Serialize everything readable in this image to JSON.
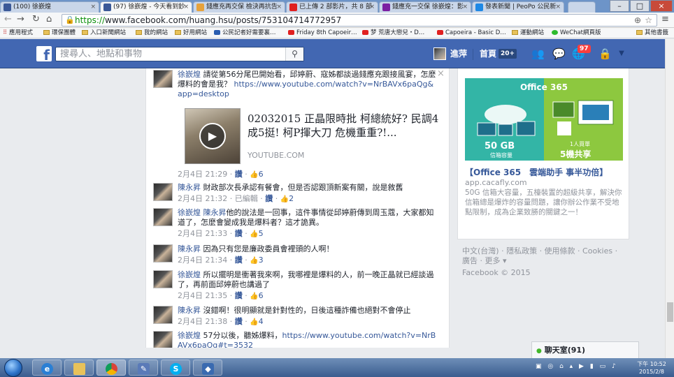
{
  "browser": {
    "tabs": [
      {
        "label": "(100) 徐嶔煌",
        "fav": "#3b5998"
      },
      {
        "label": "徐嶔煌 - 今天看到鈔…",
        "fav": "#3b5998"
      },
      {
        "label": "(97) 徐嶔煌 - 今天看到鈔",
        "fav": "#3b5998"
      },
      {
        "label": "錢應充再交保 檢決再抗告",
        "fav": "#e6a23c"
      },
      {
        "label": "已上傳 2 部影片，共 8 部",
        "fav": "#e02020"
      },
      {
        "label": "錢應充一交保 徐嶔煌：影",
        "fav": "#7b1fa2"
      },
      {
        "label": "發表新聞 | PeoPo 公民新",
        "fav": "#1e88e5"
      }
    ],
    "tab_close_glyph": "×",
    "url_scheme": "https://",
    "url_rest": "www.facebook.com/huang.hsu/posts/753104714772957",
    "bookmarks": [
      "應用程式",
      "環保團體",
      "入口新聞網站",
      "我的網站",
      "好用網站",
      "公民記者好需要裏…",
      "Friday 8th Capoeir…",
      "梦 荒唐大戀兒・D…",
      "Capoeira - Basic D…",
      "運動網站",
      "WeChat網頁版",
      "其他書籤"
    ]
  },
  "facebook": {
    "logo": "f",
    "search_placeholder": "搜尋人、地點和事物",
    "user_name": "進萍",
    "home_label": "首頁",
    "home_count": "20+",
    "notif_count": "97"
  },
  "thread": {
    "close_glyph": "×",
    "comments": [
      {
        "name": "徐嶔煌",
        "text": "請從第56分尾巴開始看，邱婷蔚、寇姊都談過錢應充跟接風宴，怎麼爆料的會是我？",
        "link": "https://www.youtube.com/watch?v=NrBAVx6paQg&app=desktop",
        "time": "2月4日 21:29",
        "action": "讚",
        "likes": "6"
      },
      {
        "name": "陳永昇",
        "text": "財政部次長承認有餐會，但是否認跟頂新案有關，說是敘舊",
        "time": "2月4日 21:32",
        "edited": "已編輯",
        "action": "讚",
        "likes": "2"
      },
      {
        "name": "徐嶔煌",
        "mention": "陳永昇",
        "text": "他的說法是一回事，這件事情從邱婷蔚傳到周玉蔻，大家都知道了，怎麼會變成我是爆料者？這才詭異。",
        "time": "2月4日 21:33",
        "action": "讚",
        "likes": "5"
      },
      {
        "name": "陳永昇",
        "text": "因為只有您是廉政委員會裡頭的人啊！",
        "time": "2月4日 21:34",
        "action": "讚",
        "likes": "3"
      },
      {
        "name": "徐嶔煌",
        "text": "所以擺明是衝著我來啊，我哪裡是爆料的人，前一晚正晶就已經談過了，再前面邱婷蔚也講過了",
        "time": "2月4日 21:35",
        "action": "讚",
        "likes": "6"
      },
      {
        "name": "陳永昇",
        "text": "沒錯啊！很明顯就是針對性的，日後這種詐備也絕對不會停止",
        "time": "2月4日 21:38",
        "action": "讚",
        "likes": "4"
      },
      {
        "name": "徐嶔煌",
        "text": "57分以後，聽姊爆料，",
        "link": "https://www.youtube.com/watch?v=NrBAVx6paQg#t=3532"
      }
    ],
    "preview": {
      "title": "02032015 正晶限時批 柯總統好? 民調4成5挺! 柯P揮大刀 危機重重?!...",
      "source": "YOUTUBE.COM",
      "play_glyph": "▶"
    }
  },
  "ad": {
    "brand": "Office 365",
    "storage": "50 GB",
    "storage_sub": "信箱容量",
    "share_sub": "1人買單",
    "share": "5機共享",
    "title": "【Office 365　雲端助手 事半功倍】",
    "url": "app.cacafly.com",
    "text": "50G 信箱大容量，五檯裝置的超級共享，解決你信箱總是爆炸的容量問題，讓你辦公作業不受地點限制，成為企業致勝的關鍵之一！"
  },
  "footer": {
    "line1": "中文(台灣) · 隱私政策 · 使用條款 · Cookies ·",
    "line2": "廣告 · 更多 ▾",
    "copyright": "Facebook © 2015"
  },
  "chat": {
    "label": "聊天室(91)"
  },
  "taskbar": {
    "time": "下午 10:52",
    "date": "2015/2/8"
  },
  "colors": {
    "fb_blue": "#4267b2",
    "link": "#365899",
    "office_teal": "#33b5a6",
    "office_green": "#8dc83f"
  }
}
